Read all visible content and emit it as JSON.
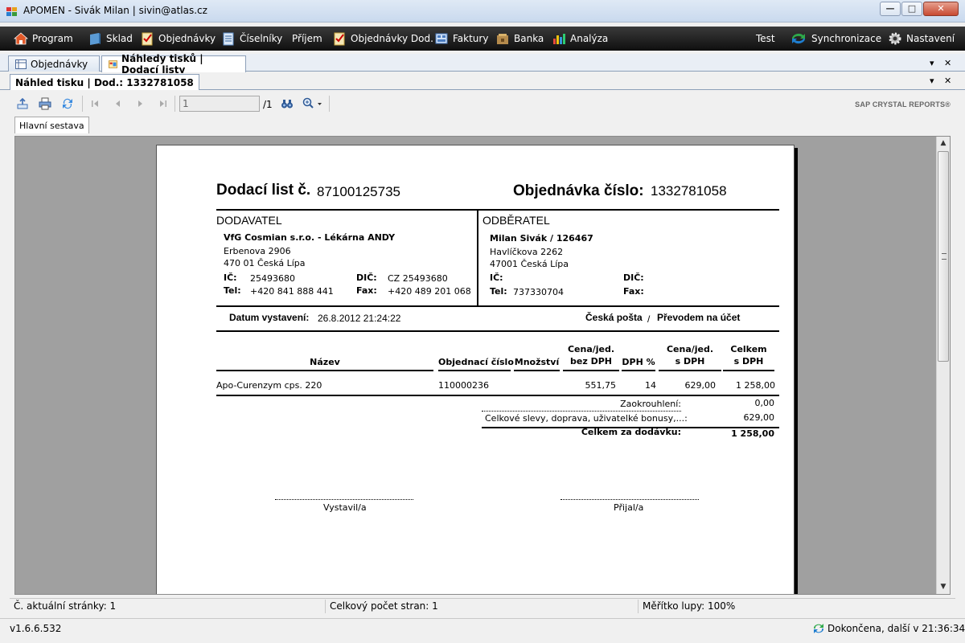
{
  "window": {
    "title": "APOMEN - Sivák Milan | sivin@atlas.cz",
    "minimize_glyph": "—",
    "maximize_glyph": "□",
    "close_glyph": "✕"
  },
  "menu": {
    "program": "Program",
    "sklad": "Sklad",
    "objednavky": "Objednávky",
    "ciselniky": "Číselníky",
    "prijem": "Příjem",
    "objednavky_dod": "Objednávky Dod.",
    "faktury": "Faktury",
    "banka": "Banka",
    "analyza": "Analýza",
    "test": "Test",
    "synchronizace": "Synchronizace",
    "nastaveni": "Nastavení"
  },
  "tabs": [
    {
      "label": "Objednávky",
      "active": false
    },
    {
      "label": "Náhledy tisků | Dodací listy",
      "active": true
    }
  ],
  "doc_tab": "Náhled tisku | Dod.: 1332781058",
  "strip_controls": {
    "dropdown": "▾",
    "close": "✕"
  },
  "toolbar": {
    "page_input": "1",
    "page_total": "/1",
    "brand": "SAP CRYSTAL REPORTS®"
  },
  "subtab": "Hlavní sestava",
  "report": {
    "dl_label": "Dodací list č.",
    "dl_number": "87100125735",
    "obj_label": "Objednávka číslo:",
    "obj_number": "1332781058",
    "supplier": {
      "title": "DODAVATEL",
      "name": "VfG Cosmian s.r.o. - Lékárna ANDY",
      "street": "Erbenova 2906",
      "city": "470 01 Česká Lípa",
      "ic_label": "IČ:",
      "ic": "25493680",
      "dic_label": "DIČ:",
      "dic": "CZ 25493680",
      "tel_label": "Tel:",
      "tel": "+420 841 888 441",
      "fax_label": "Fax:",
      "fax": "+420 489 201 068"
    },
    "customer": {
      "title": "ODBĚRATEL",
      "name": "Milan Sivák / 126467",
      "street": "Havlíčkova 2262",
      "city": "47001 Česká Lípa",
      "ic_label": "IČ:",
      "dic_label": "DIČ:",
      "tel_label": "Tel:",
      "tel": "737330704",
      "fax_label": "Fax:"
    },
    "issue_label": "Datum vystavení:",
    "issue_date": "26.8.2012  21:24:22",
    "shipping": "Česká pošta",
    "slash": "/",
    "payment": "Převodem na účet",
    "columns": {
      "nazev": "Název",
      "obj_cislo": "Objednací číslo",
      "mnozstvi": "Množství",
      "cena_bez": "Cena/jed.\nbez DPH",
      "dph": "DPH %",
      "cena_s": "Cena/jed.\ns DPH",
      "celkem": "Celkem\ns DPH"
    },
    "rows": [
      {
        "nazev": "Apo-Curenzym cps. 220",
        "obj_cislo": "110000236",
        "mnozstvi": "",
        "cena_bez": "551,75",
        "dph": "14",
        "cena_s": "629,00",
        "celkem": "1 258,00"
      }
    ],
    "rounding_label": "Zaokrouhlení:",
    "rounding_value": "0,00",
    "discounts_label": "Celkové slevy, doprava, uživatelké bonusy,...:",
    "discounts_value": "629,00",
    "total_label": "Celkem za dodávku:",
    "total_value": "1 258,00",
    "sign_issued": "Vystavil/a",
    "sign_received": "Přijal/a"
  },
  "status": {
    "current_page": "Č. aktuální stránky: 1",
    "total_pages": "Celkový počet stran: 1",
    "zoom": "Měřítko lupy: 100%"
  },
  "app_status": {
    "version": "v1.6.6.532",
    "sync": "Dokončena, další v 21:36:34"
  },
  "colors": {
    "menubar": "#1a1a1a",
    "title_gradient": "#c9d9ee",
    "preview_bg": "#a0a0a0",
    "close_button": "#c84a32"
  }
}
